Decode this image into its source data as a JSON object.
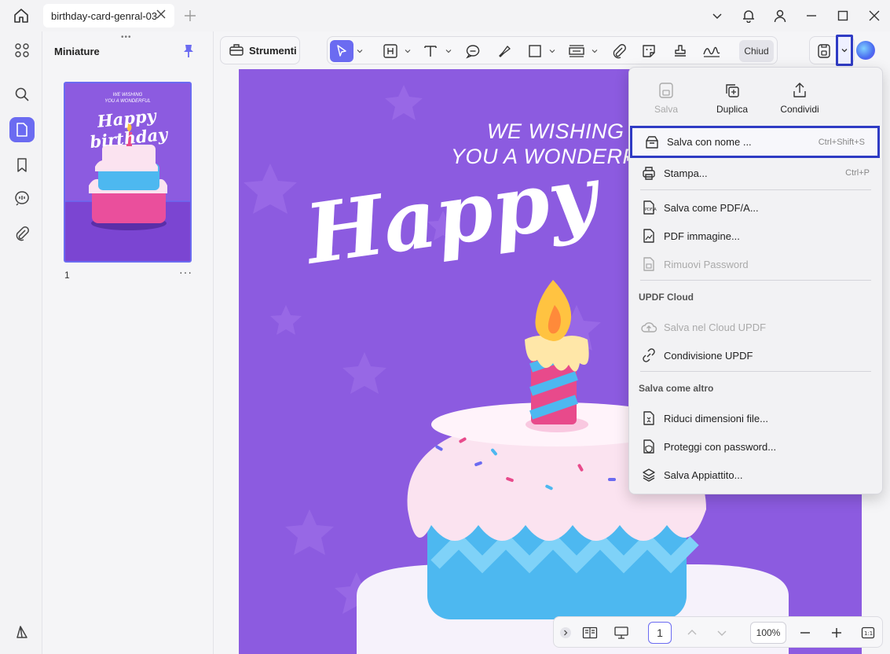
{
  "window": {
    "tab_title": "birthday-card-genral-03"
  },
  "sidebar": {
    "panel_title": "Miniature",
    "grip": "•••",
    "thumbnail": {
      "page_number": "1",
      "more": "···"
    }
  },
  "toolbar": {
    "tools_label": "Strumenti",
    "close_label": "Chiud"
  },
  "document": {
    "line1": "WE WISHING",
    "line2": "YOU A WONDERFUL",
    "headline": "Happy birthday",
    "thumb_line1": "WE WISHING",
    "thumb_line2": "YOU A WONDERFUL",
    "thumb_headline": "Happy birthday",
    "card_bg_color": "#8c5be0"
  },
  "menu": {
    "quick_actions": [
      {
        "label": "Salva",
        "enabled": false
      },
      {
        "label": "Duplica",
        "enabled": true
      },
      {
        "label": "Condividi",
        "enabled": true
      }
    ],
    "items": [
      {
        "label": "Salva con nome ...",
        "shortcut": "Ctrl+Shift+S",
        "enabled": true,
        "highlighted": true
      },
      {
        "label": "Stampa...",
        "shortcut": "Ctrl+P",
        "enabled": true
      },
      {
        "label": "Salva come PDF/A...",
        "shortcut": "",
        "enabled": true
      },
      {
        "label": "PDF immagine...",
        "shortcut": "",
        "enabled": true
      },
      {
        "label": "Rimuovi Password",
        "shortcut": "",
        "enabled": false
      }
    ],
    "cloud_section": "UPDF Cloud",
    "cloud_items": [
      {
        "label": "Salva nel Cloud UPDF",
        "enabled": false
      },
      {
        "label": "Condivisione UPDF",
        "enabled": true
      }
    ],
    "other_section": "Salva come altro",
    "other_items": [
      {
        "label": "Riduci dimensioni file...",
        "enabled": true
      },
      {
        "label": "Proteggi con password...",
        "enabled": true
      },
      {
        "label": "Salva Appiattito...",
        "enabled": true
      }
    ]
  },
  "bottom": {
    "page_value": "1",
    "zoom": "100%"
  },
  "colors": {
    "accent": "#6b6bf1",
    "annotation": "#2f3bc4"
  }
}
